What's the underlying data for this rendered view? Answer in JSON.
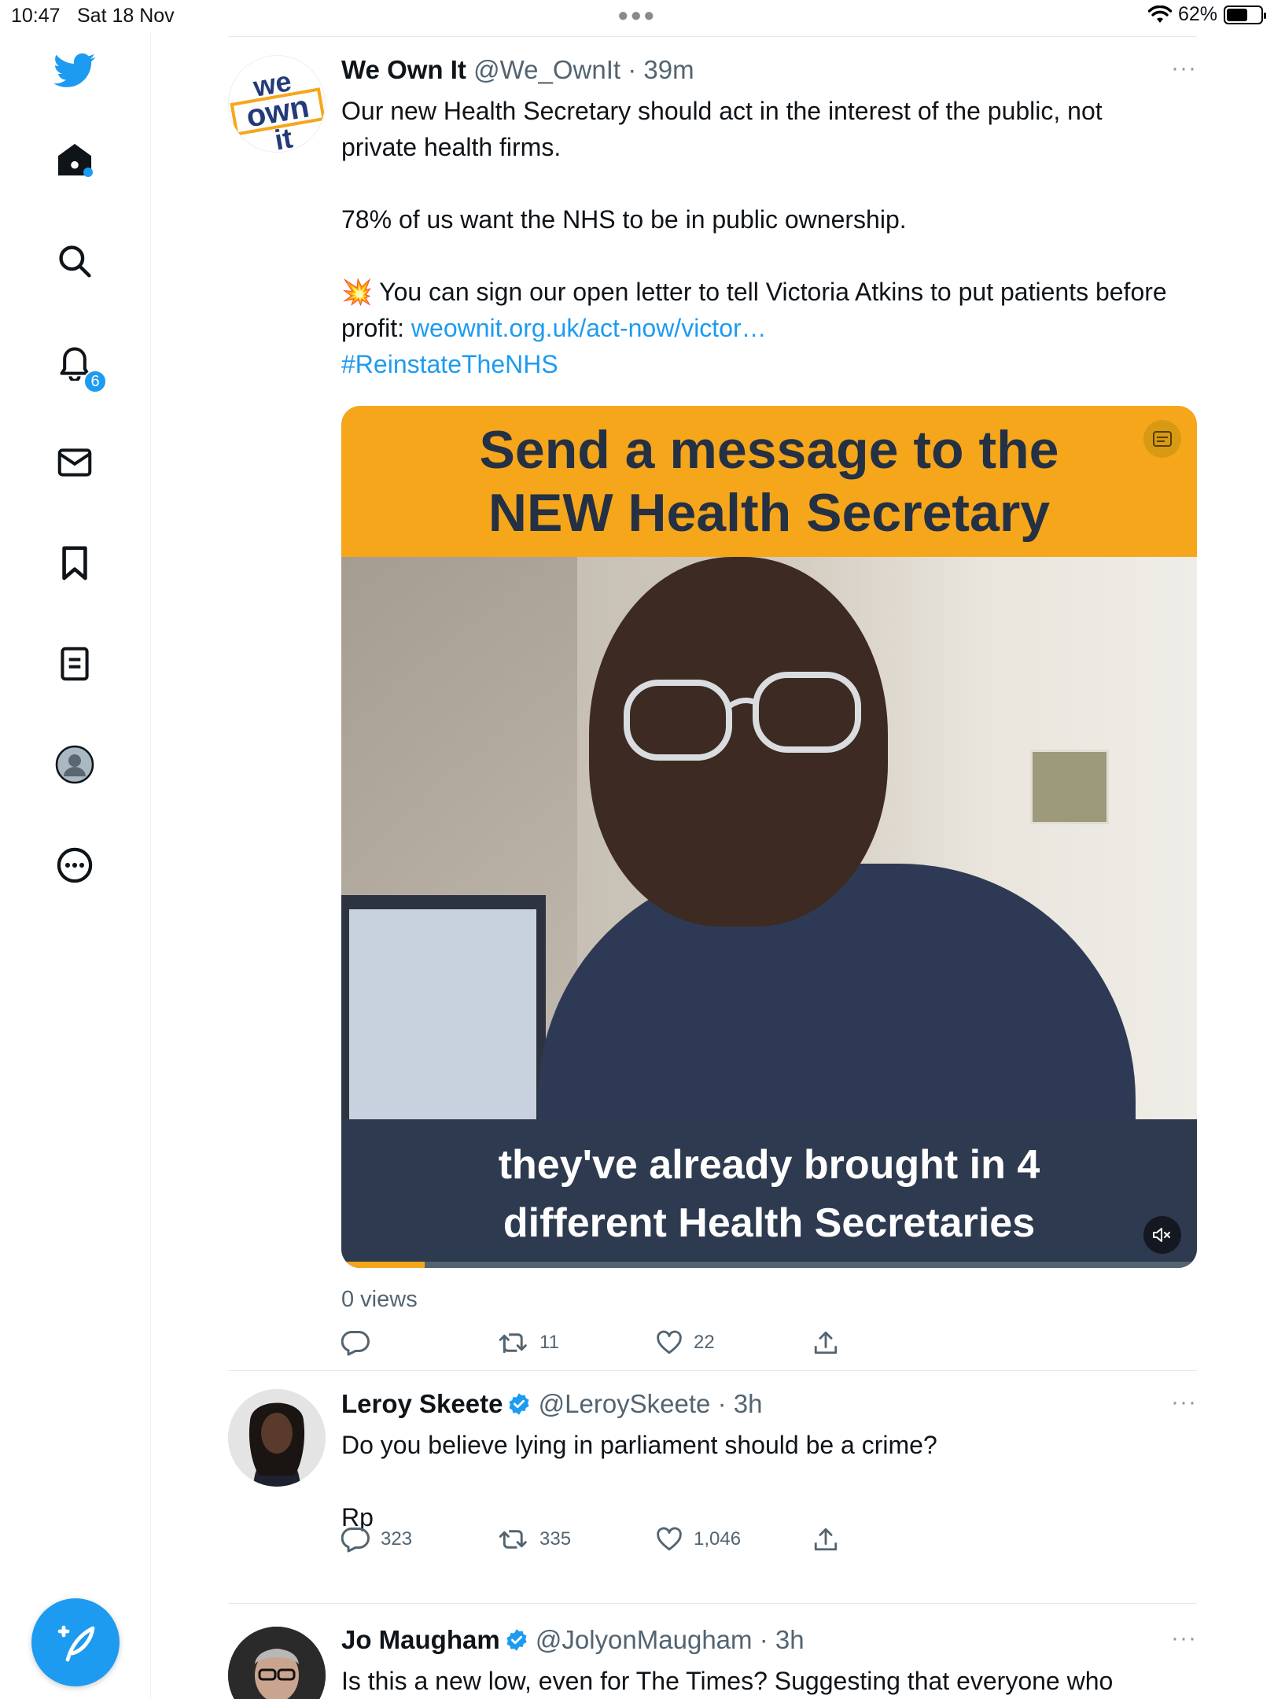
{
  "status_bar": {
    "time": "10:47",
    "date": "Sat 18 Nov",
    "battery": "62%",
    "battery_level": 0.62
  },
  "sidebar": {
    "items": [
      {
        "icon": "twitter-bird-icon"
      },
      {
        "icon": "home-icon",
        "has_new": true
      },
      {
        "icon": "search-icon"
      },
      {
        "icon": "notifications-bell-icon",
        "badge": "6"
      },
      {
        "icon": "messages-mail-icon"
      },
      {
        "icon": "bookmark-icon"
      },
      {
        "icon": "lists-icon"
      },
      {
        "icon": "profile-avatar-icon"
      },
      {
        "icon": "more-circle-icon"
      }
    ],
    "compose_icon": "compose-feather-icon"
  },
  "tweets": [
    {
      "name": "We Own It",
      "handle": "@We_OwnIt",
      "time": "· 39m",
      "avatar_text": [
        "we",
        "own",
        "it"
      ],
      "more": "···",
      "paragraphs": [
        "Our new Health Secretary should act in the interest of the public, not private health firms.",
        "78% of us want the NHS to be in public ownership.",
        "You can sign our open letter to tell Victoria Atkins to put patients before profit:"
      ],
      "emoji": "💥",
      "link": "weownit.org.uk/act-now/victor…",
      "hashtag": "#ReinstateTheNHS",
      "media": {
        "top_line1": "Send a message to the",
        "top_line2": "NEW Health Secretary",
        "bottom_line1": "they've already brought in 4",
        "bottom_line2": "different Health Secretaries",
        "progress": 0.097
      },
      "views": "0 views",
      "stats": {
        "replies": "",
        "retweets": "11",
        "likes": "22"
      }
    },
    {
      "name": "Leroy Skeete",
      "handle": "@LeroySkeete",
      "time": "· 3h",
      "verified": true,
      "more": "···",
      "paragraphs": [
        "Do you believe lying in parliament should be a crime?",
        "Rp"
      ],
      "stats": {
        "replies": "323",
        "retweets": "335",
        "likes": "1,046"
      }
    },
    {
      "name": "Jo Maugham",
      "handle": "@JolyonMaugham",
      "time": "· 3h",
      "verified": true,
      "more": "···",
      "paragraphs": [
        "Is this a new low, even for The Times? Suggesting that everyone who"
      ]
    }
  ],
  "colors": {
    "accent": "#1d9bf0",
    "media_orange": "#f6a61b",
    "media_navy": "#2e3a4f"
  }
}
